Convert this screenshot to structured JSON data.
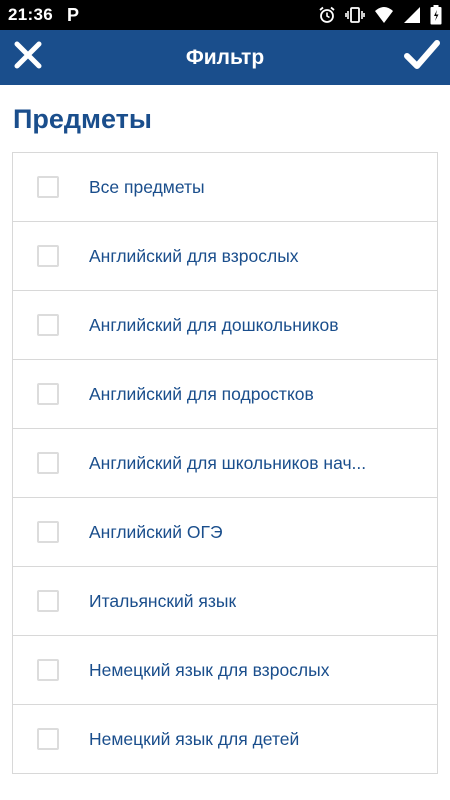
{
  "status_bar": {
    "time": "21:36",
    "app_icon": "P",
    "icons": [
      "alarm-icon",
      "vibrate-icon",
      "wifi-icon",
      "signal-icon",
      "battery-icon"
    ]
  },
  "toolbar": {
    "title": "Фильтр",
    "close_icon": "close-icon",
    "apply_icon": "checkmark-icon",
    "background": "#1a4e8c"
  },
  "section": {
    "title": "Предметы"
  },
  "subjects": [
    {
      "label": "Все предметы",
      "checked": false
    },
    {
      "label": "Английский для взрослых",
      "checked": false
    },
    {
      "label": "Английский для дошкольников",
      "checked": false
    },
    {
      "label": "Английский для подростков",
      "checked": false
    },
    {
      "label": "Английский для школьников нач...",
      "checked": false
    },
    {
      "label": "Английский ОГЭ",
      "checked": false
    },
    {
      "label": "Итальянский язык",
      "checked": false
    },
    {
      "label": "Немецкий язык для взрослых",
      "checked": false
    },
    {
      "label": "Немецкий язык для детей",
      "checked": false
    }
  ],
  "colors": {
    "accent": "#1a4e8c",
    "divider": "#d8d8d8",
    "checkbox_border": "#dcdcdc"
  }
}
